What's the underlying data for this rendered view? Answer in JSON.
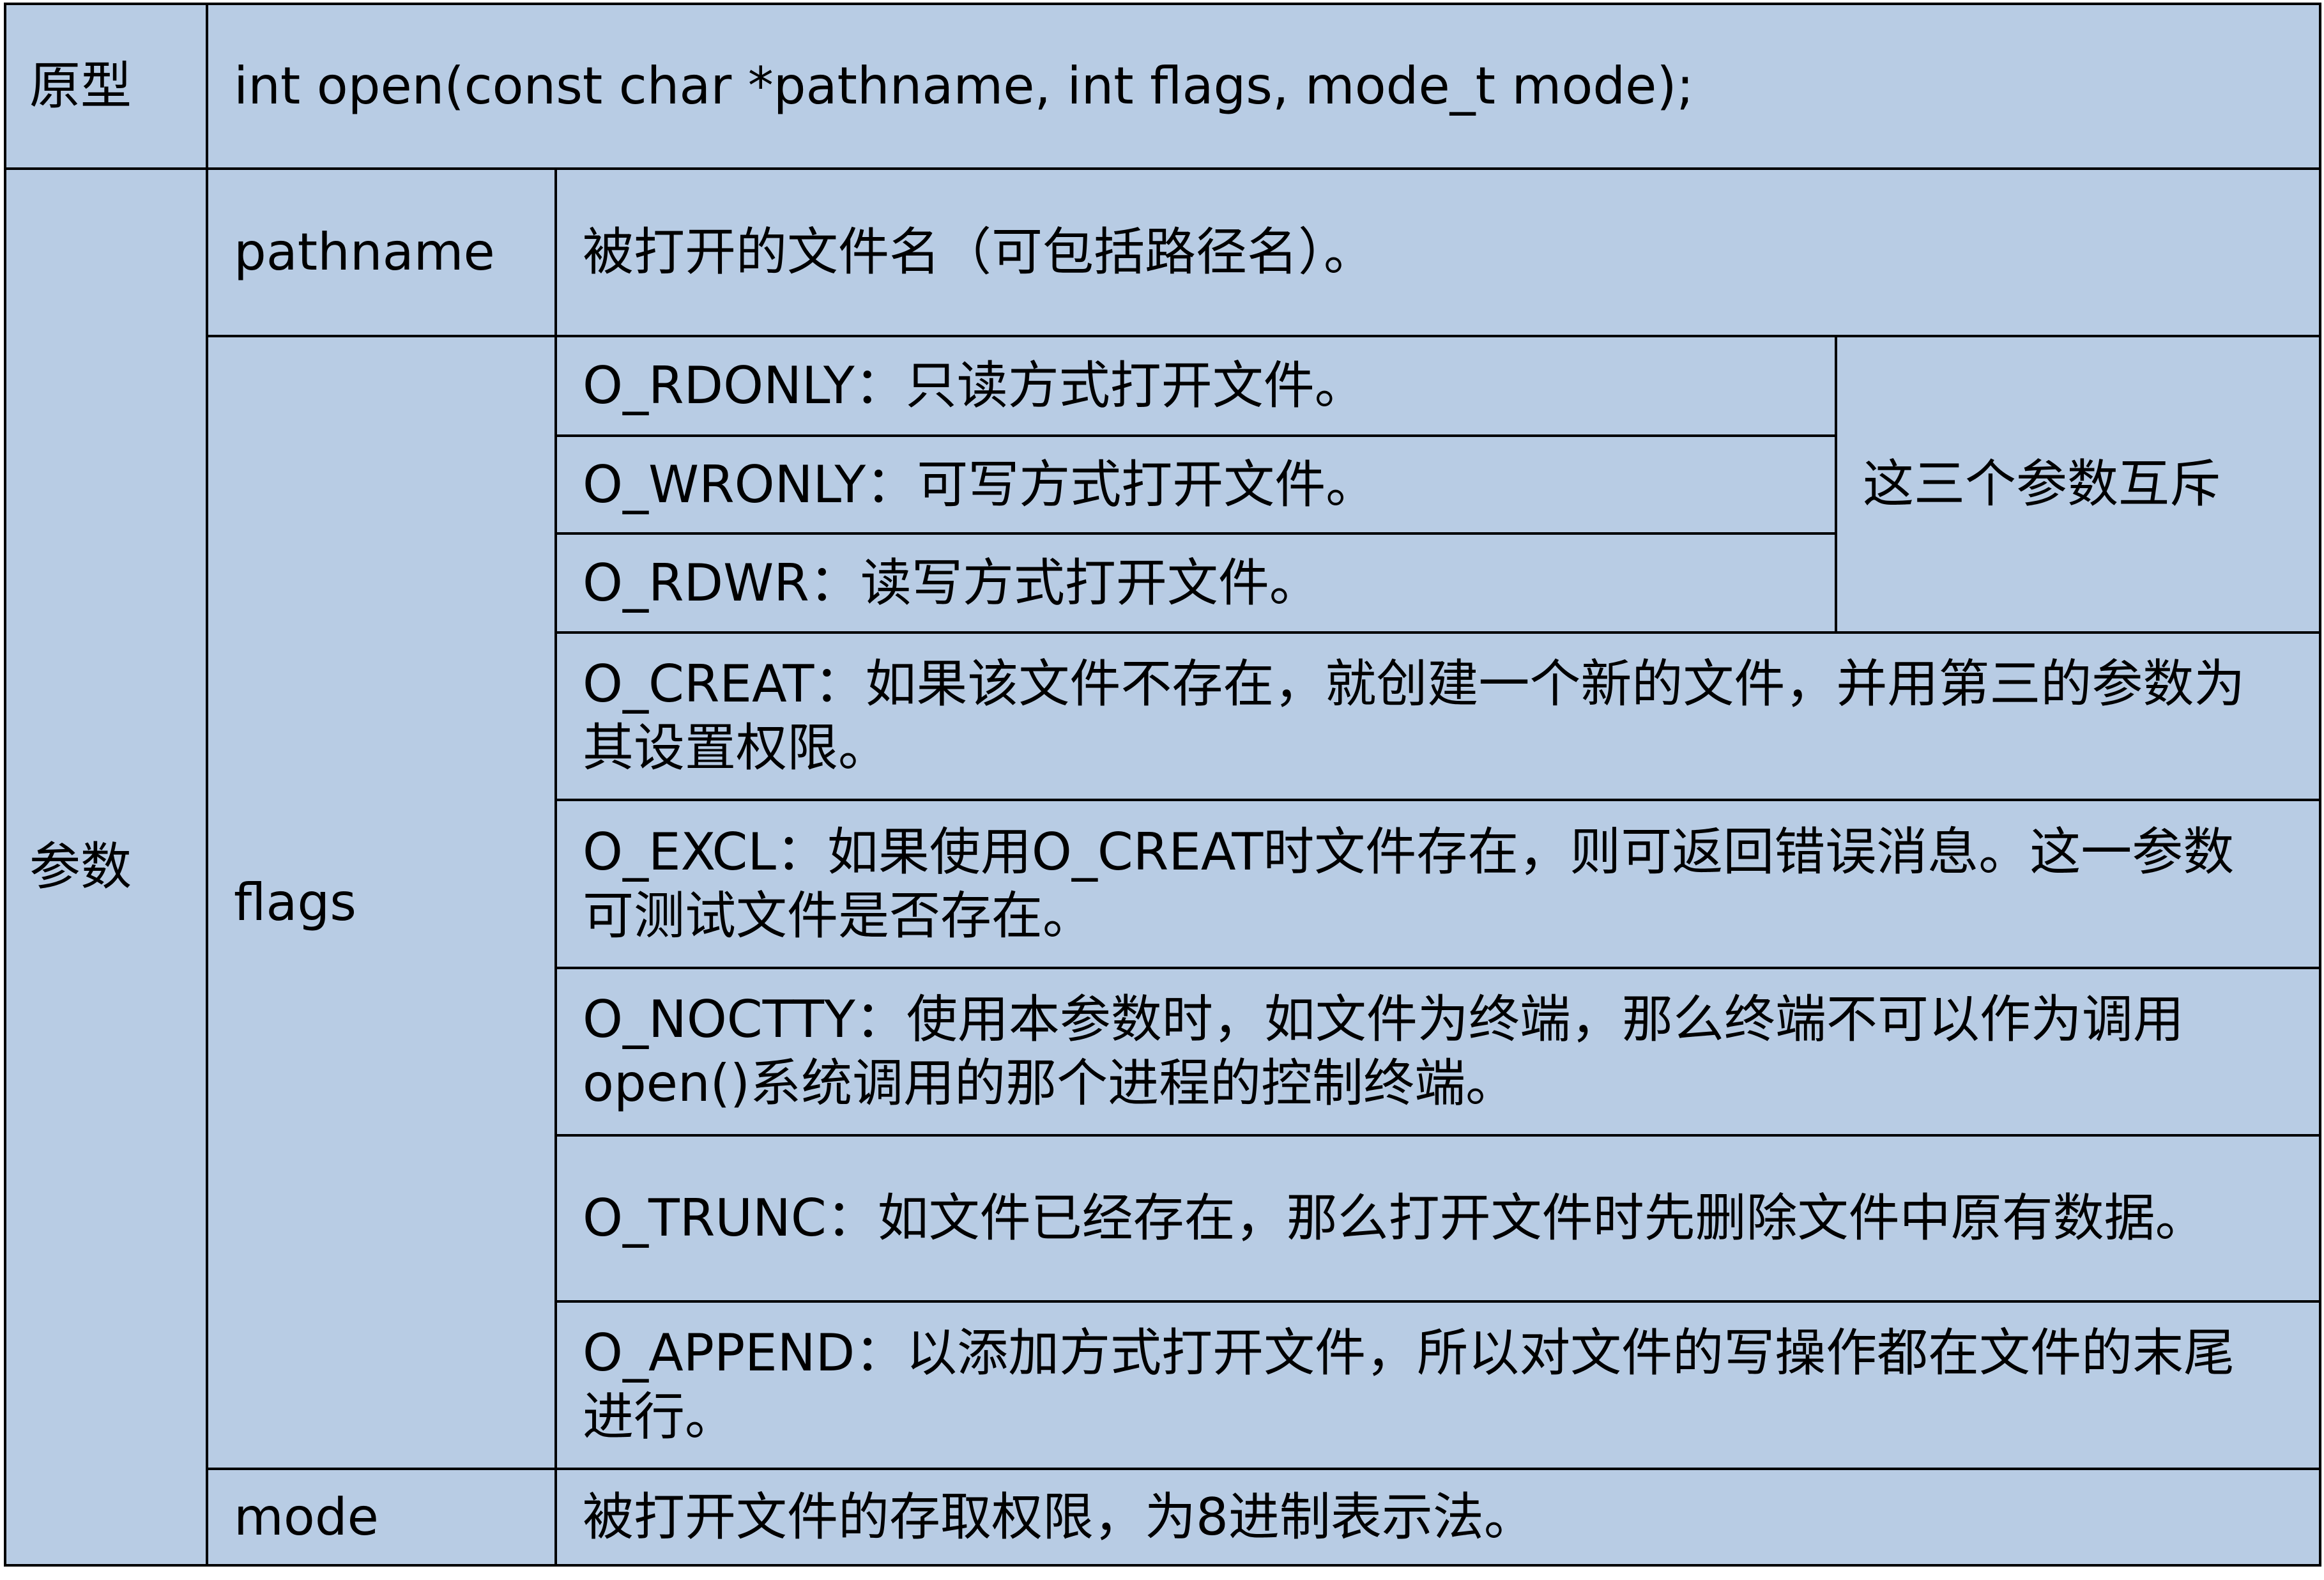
{
  "document": {
    "prototype": {
      "label": "原型",
      "signature": "int open(const char *pathname, int flags, mode_t mode);"
    },
    "parameters": {
      "label": "参数",
      "pathname": {
        "name": "pathname",
        "description": "被打开的文件名（可包括路径名）。"
      },
      "flags": {
        "name": "flags",
        "options": [
          {
            "lines": [
              "O_RDONLY：只读方式打开文件。"
            ]
          },
          {
            "lines": [
              "O_WRONLY：可写方式打开文件。"
            ]
          },
          {
            "lines": [
              "O_RDWR：读写方式打开文件。"
            ]
          },
          {
            "lines": [
              "O_CREAT：如果该文件不存在，就创建一个新的文件，并用第三的参数为",
              "其设置权限。"
            ]
          },
          {
            "lines": [
              "O_EXCL：如果使用O_CREAT时文件存在，则可返回错误消息。这一参数",
              "可测试文件是否存在。"
            ]
          },
          {
            "lines": [
              "O_NOCTTY：使用本参数时，如文件为终端，那么终端不可以作为调用",
              "open()系统调用的那个进程的控制终端。"
            ]
          },
          {
            "lines": [
              "O_TRUNC：如文件已经存在，那么打开文件时先删除文件中原有数据。"
            ]
          },
          {
            "lines": [
              "O_APPEND：以添加方式打开文件，所以对文件的写操作都在文件的末尾",
              "进行。"
            ]
          }
        ],
        "mutex_note": "这三个参数互斥"
      },
      "mode": {
        "name": "mode",
        "description": "被打开文件的存取权限，为8进制表示法。"
      }
    }
  },
  "colors": {
    "cell_background": "#b8cce4",
    "border": "#000000",
    "text": "#000000",
    "page_background": "#ffffff"
  }
}
